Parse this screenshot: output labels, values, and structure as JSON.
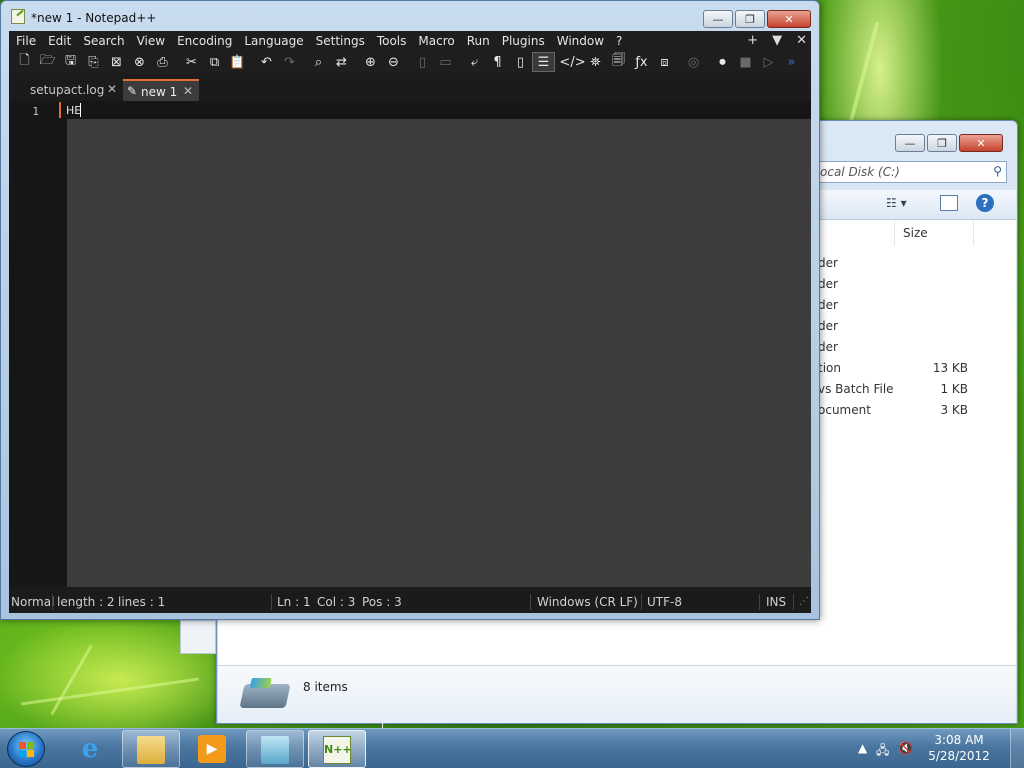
{
  "notepad": {
    "title": "*new 1 - Notepad++",
    "menu": [
      "File",
      "Edit",
      "Search",
      "View",
      "Encoding",
      "Language",
      "Settings",
      "Tools",
      "Macro",
      "Run",
      "Plugins",
      "Window",
      "?"
    ],
    "menu_right": [
      "+",
      "▼",
      "✕"
    ],
    "tabs": [
      {
        "label": "setupact.log",
        "active": false
      },
      {
        "label": "new 1",
        "active": true
      }
    ],
    "editor": {
      "line_number": "1",
      "text": "HE"
    },
    "status": {
      "mode": "Normal",
      "length": "length : 2",
      "lines": "lines : 1",
      "ln": "Ln : 1",
      "col": "Col : 3",
      "pos": "Pos : 3",
      "eol": "Windows (CR LF)",
      "encoding": "UTF-8",
      "ins": "INS"
    },
    "colors": {
      "accent": "#e06e36",
      "editor_bg": "#3c3c3c",
      "gutter_bg": "#161616"
    }
  },
  "explorer": {
    "address": "ocal Disk (C:)",
    "size_header": "Size",
    "rows": [
      {
        "type": "der",
        "size": ""
      },
      {
        "type": "der",
        "size": ""
      },
      {
        "type": "der",
        "size": ""
      },
      {
        "type": "der",
        "size": ""
      },
      {
        "type": "der",
        "size": ""
      },
      {
        "type": "tion",
        "size": "13 KB"
      },
      {
        "type": "vs Batch File",
        "size": "1 KB"
      },
      {
        "type": "ocument",
        "size": "3 KB"
      }
    ],
    "item_count": "8 items"
  },
  "taskbar": {
    "time": "3:08 AM",
    "date": "5/28/2012"
  },
  "icons": {
    "window_minimize": "—",
    "window_restore": "❐",
    "window_close": "✕",
    "search": "⚲",
    "help": "?"
  }
}
